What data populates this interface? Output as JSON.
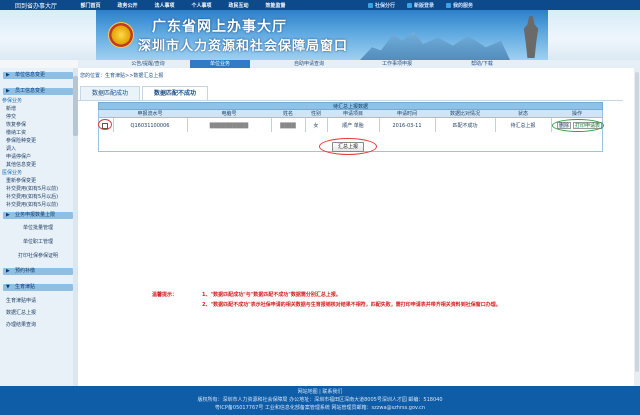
{
  "topnav": {
    "home": "回到省办事大厅",
    "items": [
      "部门首页",
      "政务公开",
      "法人事项",
      "个人事项",
      "政民互动",
      "效能监督"
    ],
    "right_items": [
      "社保分行",
      "新版登录",
      "我的服务"
    ]
  },
  "banner": {
    "title_line1": "广东省网上办事大厅",
    "title_line2": "深圳市人力资源和社会保障局窗口"
  },
  "subtabs": [
    "公告/提醒/查询",
    "单位业务",
    "自助申请查询",
    "工作事项申报",
    "帮助/下载"
  ],
  "subtabs_active_index": 1,
  "sidebar": {
    "head1": "单位信息变更",
    "head2": "员工信息变更",
    "cat1": "参保业务",
    "items1": [
      "新增",
      "停交",
      "恢复参保",
      "缴纳工资",
      "参保险种变更",
      "调入",
      "申请停保户",
      "其他信息变更"
    ],
    "cat2": "医保业务",
    "items2": [
      "重新参保变更",
      "补交费用(如有5月以前)",
      "补交费用(如有5月以后)",
      "补交费用(如有5月以前)"
    ],
    "head3": "业务申报数量上限",
    "items3": [
      "单位批量管理",
      "单位职工管理",
      "打印社保参保证明"
    ],
    "head4": "预约补缴",
    "head5": "生育津贴",
    "items5": [
      "生育津贴申请",
      "数据汇总上报",
      "办理结果查询"
    ]
  },
  "main": {
    "breadcrumb": "您的位置：生育津贴>>数据汇总上报",
    "tabs": [
      "数据匹配成功",
      "数据匹配不成功"
    ],
    "tabs_active_index": 1,
    "table_caption": "待汇总上报数据",
    "headers": [
      "",
      "申报流水号",
      "电脑号",
      "姓名",
      "性别",
      "申请项目",
      "申请时间",
      "数据比对情况",
      "状态",
      "操作"
    ],
    "row": {
      "serial": "Q16031100006",
      "computer_no": "██████████",
      "name": "████",
      "gender": "女",
      "item": "顺产 单胎",
      "time": "2016-03-11",
      "match": "匹配不成功",
      "status": "待汇总上报",
      "op_delete": "删除",
      "op_print": "打印申请表"
    },
    "submit_label": "汇总上报",
    "tip_label": "温馨提示：",
    "tip_line1": "1、\"数据匹配成功\"与\"数据匹配不成功\"数据需分别汇总上报。",
    "tip_line2": "2、\"数据匹配不成功\"表示社保申请的相关数据与生育报销核对结果不相符，匹配失败，需打印申请表并带齐相关资料到社保窗口办理。"
  },
  "footer": {
    "line1": "网站地图 | 联系我们",
    "line2": "版权所有：深圳市人力资源和社会保障局  办公地址：深圳市福田区深南大道8005号深圳人才园  邮编：518040",
    "line3": "粤ICP备05017767号   工业和信息化部备案管理系统   网站管理员邮箱：szzwa@szhrss.gov.cn"
  },
  "colors": {
    "top_nav": "#0d4a8c",
    "accent": "#2f7bc4",
    "tip_red": "#d22020",
    "footer": "#0f5ca7"
  }
}
